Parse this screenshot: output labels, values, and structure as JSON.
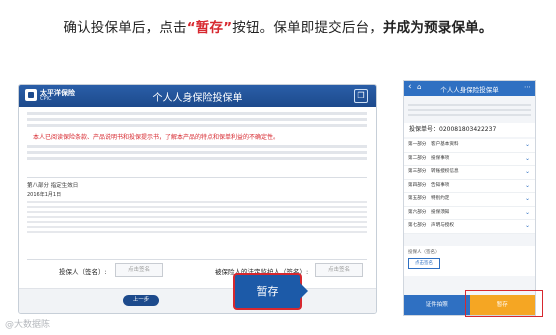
{
  "headline": {
    "part1": "确认投保单后，点击",
    "highlight": "“暂存”",
    "part2": "按钮。保单即提交后台，",
    "bold": "并成为预录保单。"
  },
  "tablet": {
    "logo_name": "太平洋保险",
    "logo_sub": "CPIC",
    "title": "个人人身保险投保单",
    "warning": "本人已阅读保险条款、产品说明书和投保提示书，了解本产品的特点和保单利益的不确定性。",
    "part8_title": "第八部分 指定生效日",
    "part8_date": "2016年1月1日",
    "applicant_sign_label": "投保人（签名）:",
    "guardian_sign_label": "被保险人的法定监护人（签名）:",
    "sign_placeholder": "点击签名",
    "prev_label": "上一步",
    "save_label": "暂存"
  },
  "phone": {
    "title": "个人人身保险投保单",
    "policy_no": "投保单号：020081803422237",
    "items": [
      {
        "part": "第一部分",
        "name": "客户基本资料"
      },
      {
        "part": "第二部分",
        "name": "投保事项"
      },
      {
        "part": "第三部分",
        "name": "转账授权信息"
      },
      {
        "part": "第四部分",
        "name": "告知事项"
      },
      {
        "part": "第五部分",
        "name": "特别约定"
      },
      {
        "part": "第六部分",
        "name": "投保须知"
      },
      {
        "part": "第七部分",
        "name": "声明与授权"
      }
    ],
    "sign_label": "投保人（签名）",
    "sign_btn": "点击签名",
    "cert_btn": "证件拍照",
    "save_btn": "暂存"
  },
  "watermark": "@大数据陈"
}
